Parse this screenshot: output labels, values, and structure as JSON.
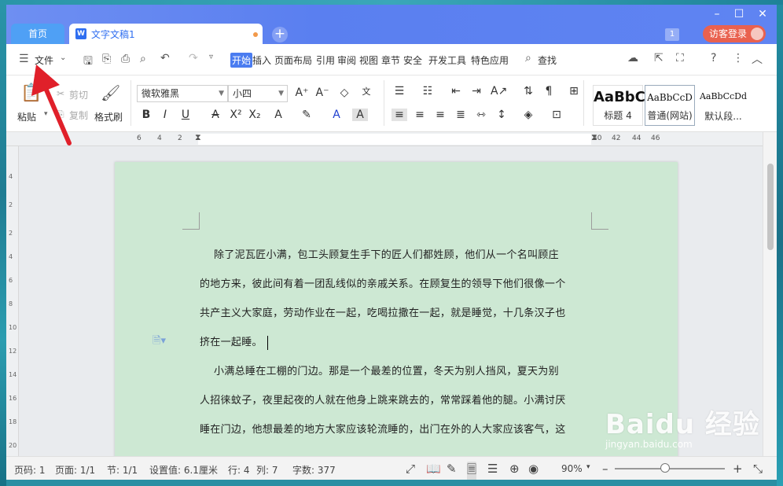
{
  "tabs": {
    "home": "首页",
    "doc_title": "文字文稿1"
  },
  "window": {
    "login": "访客登录",
    "badge": "1"
  },
  "menu": {
    "file": "文件",
    "items": [
      "开始",
      "插入",
      "页面布局",
      "引用",
      "审阅",
      "视图",
      "章节",
      "安全",
      "开发工具",
      "特色应用"
    ],
    "search": "查找"
  },
  "ribbon": {
    "paste": "粘贴",
    "cut": "剪切",
    "copy": "复制",
    "format_painter": "格式刷",
    "font": "微软雅黑",
    "size": "小四",
    "styles": [
      {
        "sample": "AaBbC",
        "label": "标题 4"
      },
      {
        "sample": "AaBbCcD",
        "label": "普通(网站)"
      },
      {
        "sample": "AaBbCcDd",
        "label": "默认段..."
      }
    ]
  },
  "ruler": {
    "top_left": [
      "6",
      "4",
      "2"
    ],
    "top_right": [
      "40",
      "42",
      "44",
      "46"
    ],
    "left": [
      "4",
      "2",
      "2",
      "4",
      "6",
      "8",
      "10",
      "12",
      "14",
      "16",
      "18",
      "20"
    ]
  },
  "document": {
    "lines": [
      "除了泥瓦匠小满，包工头顾复生手下的匠人们都姓顾，他们从一个名叫顾庄",
      "的地方来，彼此间有着一团乱线似的亲戚关系。在顾复生的领导下他们很像一个",
      "共产主义大家庭，劳动作业在一起，吃喝拉撒在一起，就是睡觉，十几条汉子也",
      "挤在一起睡。",
      "小满总睡在工棚的门边。那是一个最差的位置，冬天为别人挡风，夏天为别",
      "人招徕蚊子，夜里起夜的人就在他身上跳来跳去的，常常踩着他的腿。小满讨厌",
      "睡在门边，他想最差的地方大家应该轮流睡的，出门在外的人大家应该客气，这"
    ]
  },
  "status": {
    "page_code": "页码: 1",
    "page": "页面: 1/1",
    "section": "节: 1/1",
    "setting": "设置值: 6.1厘米",
    "row": "行: 4",
    "col": "列: 7",
    "words": "字数: 377",
    "zoom": "90%"
  },
  "watermark": {
    "brand": "Baidu 经验",
    "sub": "jingyan.baidu.com"
  }
}
